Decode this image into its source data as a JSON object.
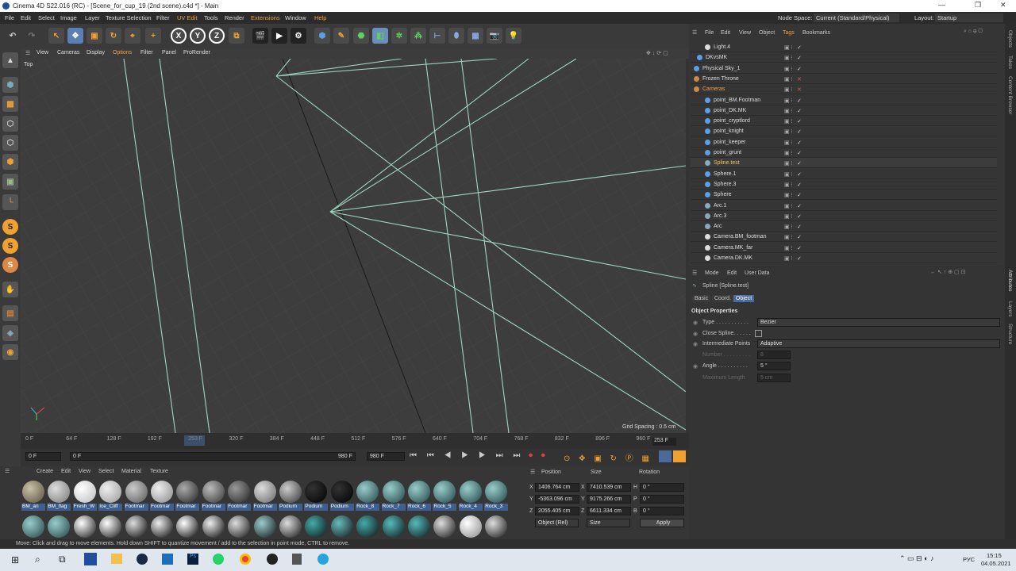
{
  "window": {
    "title": "Cinema 4D S22.016 (RC) - [Scene_for_cup_19 (2nd scene).c4d *] - Main"
  },
  "menu": [
    "File",
    "Edit",
    "Select",
    "Image",
    "Layer",
    "Texture Selection",
    "Filter",
    "UV Edit",
    "Tools",
    "Render",
    "Extensions",
    "Window",
    "Help"
  ],
  "nodespace": {
    "label": "Node Space:",
    "value": "Current (Standard/Physical)"
  },
  "layout": {
    "label": "Layout:",
    "value": "Startup"
  },
  "viewport": {
    "menu": [
      "View",
      "Cameras",
      "Display",
      "Options",
      "Filter",
      "Panel",
      "ProRender"
    ],
    "name": "Top",
    "grid_spacing": "Grid Spacing : 0.5 cm"
  },
  "timeline": {
    "ticks": [
      "0 F",
      "64 F",
      "128 F",
      "192 F",
      "253 F",
      "320 F",
      "384 F",
      "448 F",
      "512 F",
      "576 F",
      "640 F",
      "704 F",
      "768 F",
      "832 F",
      "896 F",
      "960 F"
    ],
    "current": "253 F"
  },
  "transport": {
    "start": "0 F",
    "start2": "0 F",
    "end": "980 F",
    "end2": "980 F"
  },
  "materials": {
    "menu": [
      "Create",
      "Edit",
      "View",
      "Select",
      "Material",
      "Texture"
    ],
    "row1": [
      "BM_an",
      "BM_flag",
      "Fresh_W",
      "Ice_Cliff",
      "Footmar",
      "Footmar",
      "Footmar",
      "Footmar",
      "Footmar",
      "Footmar",
      "Podium",
      "Podium",
      "Podium",
      "Rock_8",
      "Rock_7",
      "Rock_6",
      "Rock_5",
      "Rock_4",
      "Rock_3"
    ]
  },
  "coords": {
    "headers": [
      "Position",
      "Size",
      "Rotation"
    ],
    "x": "1406.764 cm",
    "y": "-5363.096 cm",
    "z": "2055.405 cm",
    "sx": "7410.539 cm",
    "sy": "9175.266 cm",
    "sz": "6611.334 cm",
    "h": "0 °",
    "p": "0 °",
    "b": "0 °",
    "mode": "Object (Rel)",
    "sizemode": "Size",
    "apply": "Apply"
  },
  "status": "Move: Click and drag to move elements. Hold down SHIFT to quantize movement / add to the selection in point mode, CTRL to remove.",
  "objects": {
    "menu": [
      "File",
      "Edit",
      "View",
      "Object",
      "Tags",
      "Bookmarks"
    ],
    "items": [
      "Light.4",
      "DKvsMK",
      "Physical Sky_1",
      "Frozen Throne",
      "Cameras",
      "point_BM.Footman",
      "point_DK.MK",
      "point_cryptlord",
      "point_knight",
      "point_keeper",
      "point_grunt",
      "Spline.test",
      "Sphere.1",
      "Sphere.3",
      "Sphere",
      "Arc.1",
      "Arc.3",
      "Arc",
      "Camera.BM_footman",
      "Camera.MK_far",
      "Camera.DK.MK"
    ]
  },
  "attributes": {
    "menu": [
      "Mode",
      "Edit",
      "User Data"
    ],
    "object": "Spline [Spline.test]",
    "tabs": [
      "Basic",
      "Coord.",
      "Object"
    ],
    "section": "Object Properties",
    "type_label": "Type . . . . . . . . . . .",
    "type": "Bezier",
    "close_label": "Close Spline. . . . . .",
    "inter_label": "Intermediate Points",
    "inter": "Adaptive",
    "number_label": "Number . . . . . . . . .",
    "number": "8",
    "angle_label": "Angle . . . . . . . . . .",
    "angle": "5 °",
    "maxlen_label": "Maximum Length",
    "maxlen": "5 cm"
  },
  "side_tabs": [
    "Objects",
    "Takes",
    "Content Browser",
    "Attributes",
    "Layers",
    "Structure"
  ],
  "clock": {
    "time": "15:15",
    "date": "04.05.2021",
    "lang": "РУС"
  }
}
